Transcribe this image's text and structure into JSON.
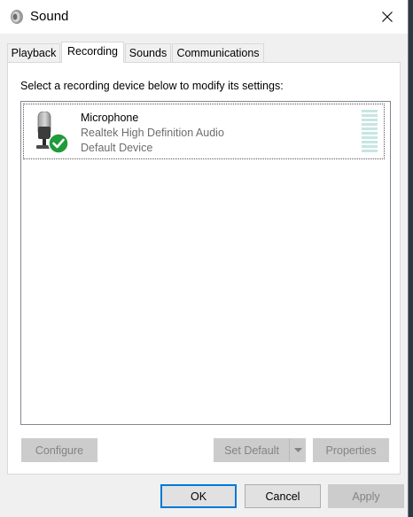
{
  "window": {
    "title": "Sound"
  },
  "tabs": [
    {
      "label": "Playback",
      "active": false
    },
    {
      "label": "Recording",
      "active": true
    },
    {
      "label": "Sounds",
      "active": false
    },
    {
      "label": "Communications",
      "active": false
    }
  ],
  "recording": {
    "instructions": "Select a recording device below to modify its settings:",
    "devices": [
      {
        "name": "Microphone",
        "driver": "Realtek High Definition Audio",
        "status": "Default Device",
        "icon": "microphone-icon",
        "badge": "default-check-icon",
        "level": 0
      }
    ],
    "buttons": {
      "configure": "Configure",
      "set_default": "Set Default",
      "properties": "Properties"
    }
  },
  "footer": {
    "ok": "OK",
    "cancel": "Cancel",
    "apply": "Apply"
  },
  "colors": {
    "accent": "#0078d7",
    "check_badge": "#1f9b3a",
    "level_meter": "#c6e6e2",
    "disabled_text": "#838383"
  }
}
